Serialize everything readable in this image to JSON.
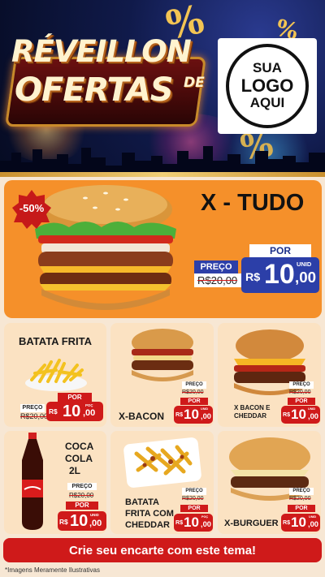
{
  "header": {
    "title_line1": "RÉVEILLON",
    "title_line2": "OFERTAS",
    "title_de": "DE",
    "percent_symbol": "%",
    "logo": {
      "line1": "SUA",
      "line2": "LOGO",
      "line3": "AQUI"
    }
  },
  "hero": {
    "name": "X - TUDO",
    "discount_badge": "-50%",
    "preco_label": "PREÇO",
    "old_price": "R$20,00",
    "por_label": "POR",
    "currency": "R$",
    "price_int": "10",
    "price_cents": ",00",
    "unid_label": "UNID"
  },
  "products": [
    {
      "name": "BATATA FRITA",
      "preco_label": "PREÇO",
      "old_price": "R$20,00",
      "por_label": "POR",
      "currency": "R$",
      "price_int": "10",
      "price_cents": ",00",
      "unit_label": "POÇ"
    },
    {
      "name": "X-BACON",
      "preco_label": "PREÇO",
      "old_price": "R$20,00",
      "por_label": "POR",
      "currency": "R$",
      "price_int": "10",
      "price_cents": ",00",
      "unit_label": "UNID"
    },
    {
      "name_line1": "X BACON E",
      "name_line2": "CHEDDAR",
      "preco_label": "PREÇO",
      "old_price": "R$20,00",
      "por_label": "POR",
      "currency": "R$",
      "price_int": "10",
      "price_cents": ",00",
      "unit_label": "UNID"
    },
    {
      "name_line1": "COCA",
      "name_line2": "COLA",
      "name_line3": "2L",
      "preco_label": "PREÇO",
      "old_price": "R$20,00",
      "por_label": "POR",
      "currency": "R$",
      "price_int": "10",
      "price_cents": ",00",
      "unit_label": "UNID"
    },
    {
      "name_line1": "BATATA",
      "name_line2": "FRITA COM",
      "name_line3": "CHEDDAR",
      "preco_label": "PREÇO",
      "old_price": "R$20,00",
      "por_label": "POR",
      "currency": "R$",
      "price_int": "10",
      "price_cents": ",00",
      "unit_label": "POÇ"
    },
    {
      "name": "X-BURGUER",
      "preco_label": "PREÇO",
      "old_price": "R$20,00",
      "por_label": "POR",
      "currency": "R$",
      "price_int": "10",
      "price_cents": ",00",
      "unit_label": "UNID"
    }
  ],
  "cta": {
    "label": "Crie seu encarte com este tema!"
  },
  "footnote": "*Imagens Meramente Ilustrativas",
  "colors": {
    "price_blue": "#2c3fa8",
    "price_red": "#cf1a1a",
    "hero_bg": "#f5902a",
    "card_bg": "#fbe2c2"
  },
  "icons": [
    "burger-illustration",
    "fries-illustration",
    "soda-bottle-illustration",
    "cheddar-fries-illustration"
  ]
}
